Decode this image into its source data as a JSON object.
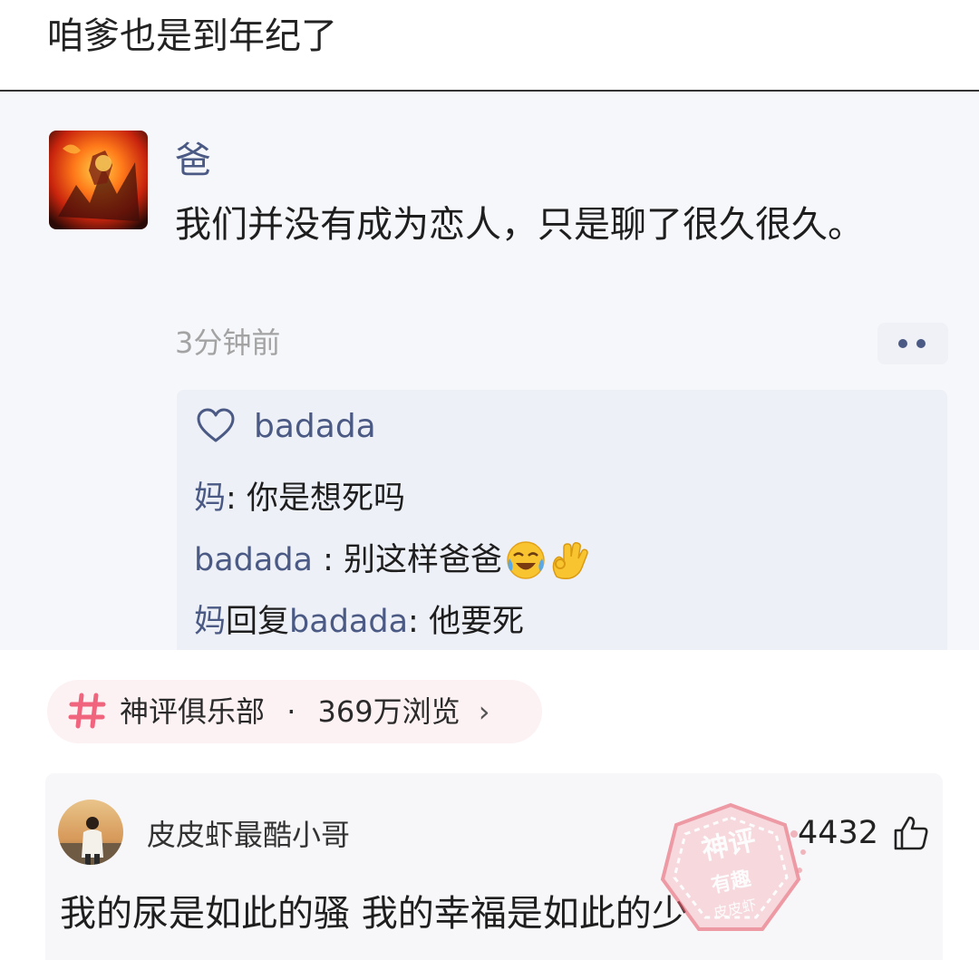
{
  "page": {
    "title": "咱爹也是到年纪了"
  },
  "post": {
    "author": "爸",
    "text": "我们并没有成为恋人，只是聊了很久很久。",
    "time": "3分钟前",
    "more_icon": "more-dots-icon",
    "likes": {
      "icon": "heart-outline-icon",
      "user": "badada"
    },
    "replies": [
      {
        "from": "妈",
        "connector": "",
        "to": "",
        "separator": ": ",
        "text": "你是想死吗",
        "emoji": ""
      },
      {
        "from": "badada",
        "connector": "",
        "to": "",
        "separator": " : ",
        "text": "别这样爸爸",
        "emoji": "😭👌"
      },
      {
        "from": "妈",
        "connector": "回复",
        "to": "badada",
        "separator": ": ",
        "text": "他要死",
        "emoji": ""
      }
    ]
  },
  "topic": {
    "icon": "hash-icon",
    "name": "神评俱乐部",
    "dot": "·",
    "views": "369万浏览",
    "arrow": "›"
  },
  "comment": {
    "username": "皮皮虾最酷小哥",
    "likes": "4432",
    "like_icon": "thumbs-up-icon",
    "text": "我的尿是如此的骚 我的幸福是如此的少",
    "watermark": {
      "line1": "神评",
      "line2": "有趣",
      "line3": "皮皮虾"
    }
  },
  "colors": {
    "accent_blue": "#4b5a84",
    "topic_pink": "#f0647d",
    "stamp_red": "#e8606f"
  }
}
